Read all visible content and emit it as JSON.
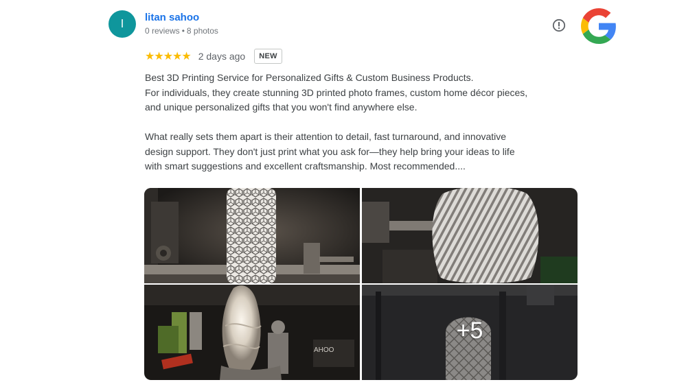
{
  "reviewer": {
    "initial": "l",
    "name": "litan sahoo",
    "reviews": "0 reviews",
    "separator": "•",
    "photos": "8 photos",
    "avatar_color": "#0f969c"
  },
  "review": {
    "stars": "★★★★★",
    "rating": 5,
    "date": "2 days ago",
    "badge": "NEW",
    "paragraph1_lines": [
      "Best 3D Printing Service for Personalized Gifts & Custom Business Products.",
      "For individuals, they create stunning 3D printed photo frames, custom home décor pieces,",
      "and unique personalized gifts that you won't find anywhere else."
    ],
    "paragraph2_lines": [
      "What really sets them apart is their attention to detail, fast turnaround, and innovative",
      "design support. They don't just print what you ask for—they help bring your ideas to life",
      "with smart suggestions and excellent craftsmanship. Most recommended...."
    ]
  },
  "photos": {
    "more_label": "+5",
    "items": [
      {
        "name": "lamp-hexagon-pattern-photo"
      },
      {
        "name": "lamp-twisted-vase-photo"
      },
      {
        "name": "lamp-spiral-photo"
      },
      {
        "name": "lamp-quilted-photo"
      }
    ]
  },
  "icons": {
    "info": "report-icon",
    "logo": "google-logo-icon"
  },
  "colors": {
    "link": "#1a73e8",
    "star": "#fbbc04",
    "text": "#3c4043",
    "muted": "#70757a"
  }
}
